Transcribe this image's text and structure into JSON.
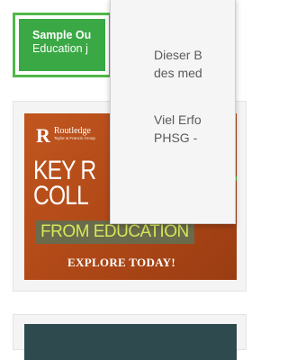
{
  "sample_tile": {
    "title": "Sample Ou",
    "subtitle": "Education j"
  },
  "ad": {
    "brand": "Routledge",
    "brand_tagline": "Taylor & Francis Group",
    "headline_line1": "KEY R",
    "headline_line2": "COLL",
    "subheadline": "FROM EDUCATION",
    "cta": "EXPLORE TODAY!",
    "colors": {
      "background": "#b24a18",
      "accent": "#52b948",
      "sub_text": "#d5e85a"
    }
  },
  "popup": {
    "line1": "Dieser B",
    "line2": "des med",
    "line3": "Viel Erfo",
    "line4": "PHSG -"
  }
}
